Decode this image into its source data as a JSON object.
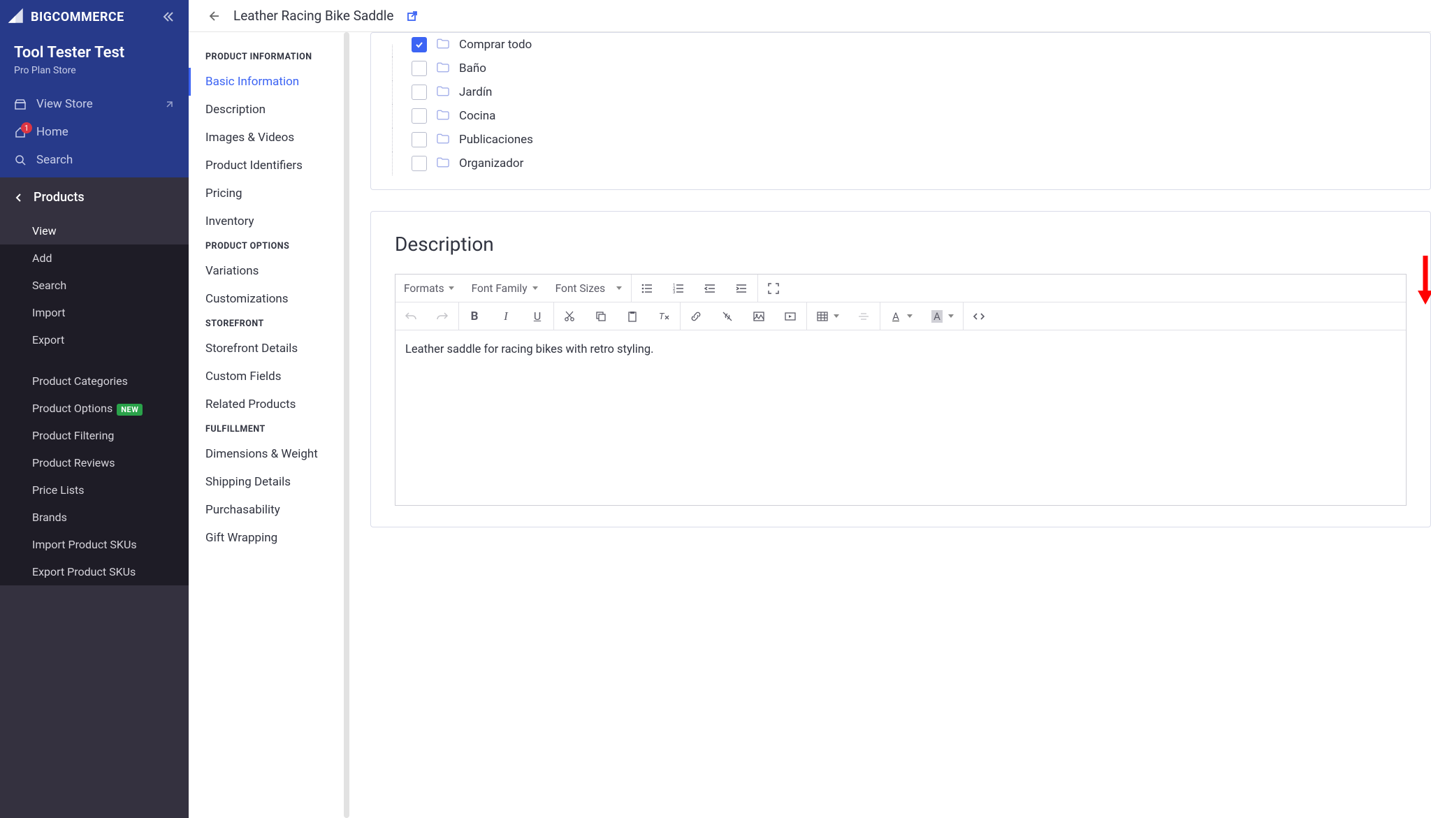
{
  "brand": "BIGCOMMERCE",
  "store": {
    "name": "Tool Tester Test",
    "plan": "Pro Plan Store"
  },
  "topnav": {
    "view_store": "View Store",
    "home": "Home",
    "home_badge": "1",
    "search": "Search"
  },
  "sidebar": {
    "section": "Products",
    "items": [
      {
        "label": "View",
        "active": true
      },
      {
        "label": "Add"
      },
      {
        "label": "Search"
      },
      {
        "label": "Import"
      },
      {
        "label": "Export"
      }
    ],
    "secondary": [
      {
        "label": "Product Categories"
      },
      {
        "label": "Product Options",
        "badge": "NEW"
      },
      {
        "label": "Product Filtering"
      },
      {
        "label": "Product Reviews"
      },
      {
        "label": "Price Lists"
      },
      {
        "label": "Brands"
      },
      {
        "label": "Import Product SKUs"
      },
      {
        "label": "Export Product SKUs"
      }
    ]
  },
  "header": {
    "title": "Leather Racing Bike Saddle"
  },
  "secnav": {
    "groups": [
      {
        "title": "PRODUCT INFORMATION",
        "items": [
          "Basic Information",
          "Description",
          "Images & Videos",
          "Product Identifiers",
          "Pricing",
          "Inventory"
        ],
        "activeIndex": 0
      },
      {
        "title": "PRODUCT OPTIONS",
        "items": [
          "Variations",
          "Customizations"
        ]
      },
      {
        "title": "STOREFRONT",
        "items": [
          "Storefront Details",
          "Custom Fields",
          "Related Products"
        ]
      },
      {
        "title": "FULFILLMENT",
        "items": [
          "Dimensions & Weight",
          "Shipping Details",
          "Purchasability",
          "Gift Wrapping"
        ]
      }
    ]
  },
  "categories": [
    {
      "label": "Comprar todo",
      "checked": true
    },
    {
      "label": "Baño",
      "checked": false
    },
    {
      "label": "Jardín",
      "checked": false
    },
    {
      "label": "Cocina",
      "checked": false
    },
    {
      "label": "Publicaciones",
      "checked": false
    },
    {
      "label": "Organizador",
      "checked": false
    }
  ],
  "description": {
    "heading": "Description",
    "toolbar": {
      "formats": "Formats",
      "fontfamily": "Font Family",
      "fontsizes": "Font Sizes"
    },
    "body": "Leather saddle for racing bikes with retro styling."
  }
}
